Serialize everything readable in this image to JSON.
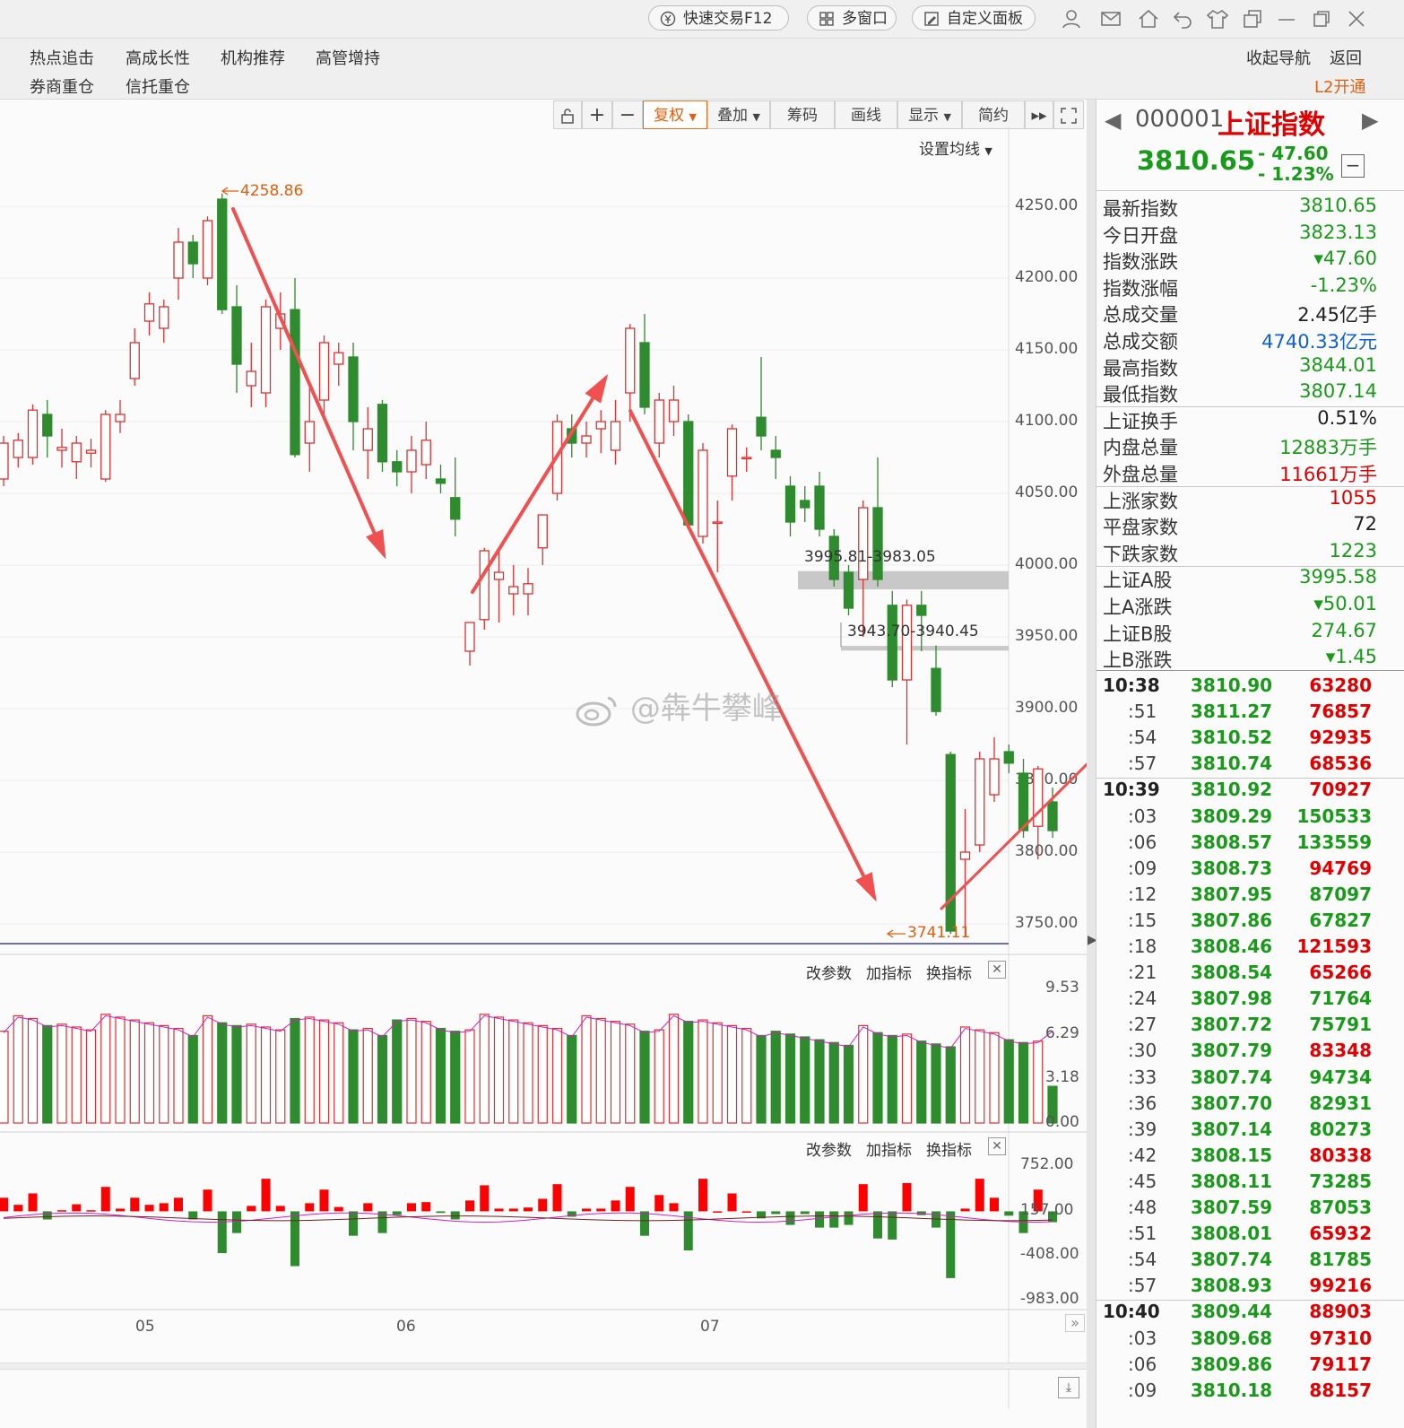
{
  "topbar": {
    "quick_trade": "快速交易F12",
    "multi_window": "多窗口",
    "custom_panel": "自定义面板"
  },
  "nav": {
    "row1": [
      "热点追击",
      "高成长性",
      "机构推荐",
      "高管增持"
    ],
    "row2": [
      "券商重仓",
      "信托重仓"
    ],
    "collapse": "收起导航",
    "back": "返回",
    "l2": "L2开通"
  },
  "toolbar": {
    "fuquan": "复权",
    "diejia": "叠加",
    "chouma": "筹码",
    "huaxian": "画线",
    "xianshi": "显示",
    "jianyue": "简约",
    "set_ma": "设置均线"
  },
  "colors": {
    "up": "#e03030",
    "down": "#2e8b2e",
    "arrow": "#f05050"
  },
  "chart_data": {
    "type": "candlestick",
    "price_ticks": [
      "4250.00",
      "4200.00",
      "4150.00",
      "4100.00",
      "4050.00",
      "4000.00",
      "3950.00",
      "3900.00",
      "3850.00",
      "3800.00",
      "3750.00"
    ],
    "x_ticks": [
      "05",
      "06",
      "07"
    ],
    "high_label": "4258.86",
    "low_label": "3741.11",
    "gaps": [
      {
        "label": "3995.81-3983.05",
        "low": 3983.05,
        "high": 3995.81
      },
      {
        "label": "3943.70-3940.45",
        "low": 3940.45,
        "high": 3943.7
      }
    ],
    "candles": [
      {
        "o": 4060,
        "c": 4085,
        "h": 4090,
        "l": 4055
      },
      {
        "o": 4075,
        "c": 4087,
        "h": 4092,
        "l": 4068
      },
      {
        "o": 4075,
        "c": 4108,
        "h": 4112,
        "l": 4070
      },
      {
        "o": 4105,
        "c": 4090,
        "h": 4115,
        "l": 4075
      },
      {
        "o": 4080,
        "c": 4082,
        "h": 4095,
        "l": 4068
      },
      {
        "o": 4072,
        "c": 4085,
        "h": 4090,
        "l": 4060
      },
      {
        "o": 4078,
        "c": 4080,
        "h": 4088,
        "l": 4068
      },
      {
        "o": 4060,
        "c": 4105,
        "h": 4108,
        "l": 4058
      },
      {
        "o": 4100,
        "c": 4105,
        "h": 4115,
        "l": 4092
      },
      {
        "o": 4130,
        "c": 4155,
        "h": 4165,
        "l": 4125
      },
      {
        "o": 4170,
        "c": 4182,
        "h": 4190,
        "l": 4160
      },
      {
        "o": 4165,
        "c": 4180,
        "h": 4185,
        "l": 4155
      },
      {
        "o": 4200,
        "c": 4225,
        "h": 4235,
        "l": 4185
      },
      {
        "o": 4225,
        "c": 4210,
        "h": 4230,
        "l": 4200
      },
      {
        "o": 4200,
        "c": 4240,
        "h": 4243,
        "l": 4195
      },
      {
        "o": 4255,
        "c": 4178,
        "h": 4259,
        "l": 4175
      },
      {
        "o": 4180,
        "c": 4140,
        "h": 4195,
        "l": 4120
      },
      {
        "o": 4125,
        "c": 4135,
        "h": 4155,
        "l": 4110
      },
      {
        "o": 4120,
        "c": 4180,
        "h": 4185,
        "l": 4110
      },
      {
        "o": 4165,
        "c": 4175,
        "h": 4190,
        "l": 4150
      },
      {
        "o": 4178,
        "c": 4077,
        "h": 4200,
        "l": 4075
      },
      {
        "o": 4085,
        "c": 4100,
        "h": 4125,
        "l": 4065
      },
      {
        "o": 4115,
        "c": 4155,
        "h": 4160,
        "l": 4105
      },
      {
        "o": 4140,
        "c": 4148,
        "h": 4155,
        "l": 4125
      },
      {
        "o": 4145,
        "c": 4100,
        "h": 4155,
        "l": 4080
      },
      {
        "o": 4080,
        "c": 4095,
        "h": 4110,
        "l": 4060
      },
      {
        "o": 4112,
        "c": 4072,
        "h": 4115,
        "l": 4065
      },
      {
        "o": 4072,
        "c": 4065,
        "h": 4080,
        "l": 4055
      },
      {
        "o": 4065,
        "c": 4080,
        "h": 4090,
        "l": 4050
      },
      {
        "o": 4070,
        "c": 4087,
        "h": 4100,
        "l": 4060
      },
      {
        "o": 4060,
        "c": 4057,
        "h": 4070,
        "l": 4050
      },
      {
        "o": 4047,
        "c": 4032,
        "h": 4075,
        "l": 4020
      },
      {
        "o": 3940,
        "c": 3960,
        "h": 3960,
        "l": 3930
      },
      {
        "o": 3962,
        "c": 4010,
        "h": 4012,
        "l": 3955
      },
      {
        "o": 3990,
        "c": 3995,
        "h": 4010,
        "l": 3960
      },
      {
        "o": 3980,
        "c": 3985,
        "h": 4000,
        "l": 3965
      },
      {
        "o": 3980,
        "c": 3987,
        "h": 3998,
        "l": 3965
      },
      {
        "o": 4012,
        "c": 4035,
        "h": 4035,
        "l": 4000
      },
      {
        "o": 4050,
        "c": 4100,
        "h": 4105,
        "l": 4045
      },
      {
        "o": 4095,
        "c": 4085,
        "h": 4105,
        "l": 4075
      },
      {
        "o": 4085,
        "c": 4090,
        "h": 4100,
        "l": 4075
      },
      {
        "o": 4095,
        "c": 4100,
        "h": 4108,
        "l": 4078
      },
      {
        "o": 4080,
        "c": 4100,
        "h": 4115,
        "l": 4070
      },
      {
        "o": 4120,
        "c": 4165,
        "h": 4168,
        "l": 4100
      },
      {
        "o": 4155,
        "c": 4110,
        "h": 4175,
        "l": 4105
      },
      {
        "o": 4085,
        "c": 4115,
        "h": 4120,
        "l": 4075
      },
      {
        "o": 4100,
        "c": 4115,
        "h": 4125,
        "l": 4090
      },
      {
        "o": 4100,
        "c": 4028,
        "h": 4105,
        "l": 4025
      },
      {
        "o": 4020,
        "c": 4080,
        "h": 4085,
        "l": 4015
      },
      {
        "o": 4030,
        "c": 4030,
        "h": 4045,
        "l": 3995
      },
      {
        "o": 4062,
        "c": 4095,
        "h": 4098,
        "l": 4045
      },
      {
        "o": 4075,
        "c": 4075,
        "h": 4082,
        "l": 4065
      },
      {
        "o": 4103,
        "c": 4090,
        "h": 4145,
        "l": 4080
      },
      {
        "o": 4080,
        "c": 4075,
        "h": 4090,
        "l": 4060
      },
      {
        "o": 4055,
        "c": 4030,
        "h": 4062,
        "l": 4020
      },
      {
        "o": 4045,
        "c": 4040,
        "h": 4055,
        "l": 4030
      },
      {
        "o": 4055,
        "c": 4025,
        "h": 4065,
        "l": 4020
      },
      {
        "o": 4020,
        "c": 3990,
        "h": 4025,
        "l": 3985
      },
      {
        "o": 3995,
        "c": 3970,
        "h": 4000,
        "l": 3965
      },
      {
        "o": 3990,
        "c": 4040,
        "h": 4045,
        "l": 3950
      },
      {
        "o": 4040,
        "c": 3990,
        "h": 4075,
        "l": 3985
      },
      {
        "o": 3972,
        "c": 3920,
        "h": 3982,
        "l": 3915
      },
      {
        "o": 3920,
        "c": 3972,
        "h": 3976,
        "l": 3875
      },
      {
        "o": 3972,
        "c": 3965,
        "h": 3982,
        "l": 3940
      },
      {
        "o": 3928,
        "c": 3898,
        "h": 3944,
        "l": 3895
      },
      {
        "o": 3868,
        "c": 3745,
        "h": 3870,
        "l": 3743
      },
      {
        "o": 3795,
        "c": 3800,
        "h": 3830,
        "l": 3741
      },
      {
        "o": 3805,
        "c": 3865,
        "h": 3870,
        "l": 3800
      },
      {
        "o": 3840,
        "c": 3865,
        "h": 3880,
        "l": 3835
      },
      {
        "o": 3870,
        "c": 3862,
        "h": 3875,
        "l": 3855
      },
      {
        "o": 3855,
        "c": 3815,
        "h": 3865,
        "l": 3810
      },
      {
        "o": 3818,
        "c": 3858,
        "h": 3860,
        "l": 3795
      },
      {
        "o": 3835,
        "c": 3815,
        "h": 3845,
        "l": 3810
      }
    ],
    "vol_ticks": [
      "9.53",
      "6.29",
      "3.18",
      "0.00"
    ],
    "macd_ticks": [
      "752.00",
      "157.00",
      "-408.00",
      "-983.00"
    ]
  },
  "panel_btns": {
    "param": "改参数",
    "add": "加指标",
    "swap": "换指标"
  },
  "watermark": "@犇牛攀峰",
  "stock": {
    "code": "000001",
    "name": "上证指数",
    "price": "3810.65",
    "change": "- 47.60",
    "change_pct": "- 1.23%"
  },
  "stats": [
    {
      "label": "最新指数",
      "value": "3810.65",
      "color": "#1a9a1a"
    },
    {
      "label": "今日开盘",
      "value": "3823.13",
      "color": "#1a9a1a"
    },
    {
      "label": "指数涨跌",
      "value": "▾47.60",
      "color": "#1a9a1a"
    },
    {
      "label": "指数涨幅",
      "value": "-1.23%",
      "color": "#1a9a1a"
    },
    {
      "label": "总成交量",
      "value": "2.45亿手",
      "color": "#222"
    },
    {
      "label": "总成交额",
      "value": "4740.33亿元",
      "color": "#1060d0"
    },
    {
      "label": "最高指数",
      "value": "3844.01",
      "color": "#1a9a1a"
    },
    {
      "label": "最低指数",
      "value": "3807.14",
      "color": "#1a9a1a"
    },
    {
      "label": "上证换手",
      "value": "0.51%",
      "color": "#222"
    },
    {
      "label": "内盘总量",
      "value": "12883万手",
      "color": "#1a9a1a"
    },
    {
      "label": "外盘总量",
      "value": "11661万手",
      "color": "#e00000"
    },
    {
      "label": "上涨家数",
      "value": "1055",
      "color": "#e00000"
    },
    {
      "label": "平盘家数",
      "value": "72",
      "color": "#222"
    },
    {
      "label": "下跌家数",
      "value": "1223",
      "color": "#1a9a1a"
    },
    {
      "label": "上证A股",
      "value": "3995.58",
      "color": "#1a9a1a"
    },
    {
      "label": "上A涨跌",
      "value": "▾50.01",
      "color": "#1a9a1a"
    },
    {
      "label": "上证B股",
      "value": "274.67",
      "color": "#1a9a1a"
    },
    {
      "label": "上B涨跌",
      "value": "▾1.45",
      "color": "#1a9a1a"
    }
  ],
  "ticks": [
    {
      "t": "10:38",
      "p": "3810.90",
      "v": "63280",
      "c": "#e00000"
    },
    {
      "t": ":51",
      "p": "3811.27",
      "v": "76857",
      "c": "#e00000"
    },
    {
      "t": ":54",
      "p": "3810.52",
      "v": "92935",
      "c": "#e00000"
    },
    {
      "t": ":57",
      "p": "3810.74",
      "v": "68536",
      "c": "#e00000"
    },
    {
      "t": "10:39",
      "p": "3810.92",
      "v": "70927",
      "c": "#e00000"
    },
    {
      "t": ":03",
      "p": "3809.29",
      "v": "150533",
      "c": "#1a9a1a"
    },
    {
      "t": ":06",
      "p": "3808.57",
      "v": "133559",
      "c": "#1a9a1a"
    },
    {
      "t": ":09",
      "p": "3808.73",
      "v": "94769",
      "c": "#e00000"
    },
    {
      "t": ":12",
      "p": "3807.95",
      "v": "87097",
      "c": "#1a9a1a"
    },
    {
      "t": ":15",
      "p": "3807.86",
      "v": "67827",
      "c": "#1a9a1a"
    },
    {
      "t": ":18",
      "p": "3808.46",
      "v": "121593",
      "c": "#e00000"
    },
    {
      "t": ":21",
      "p": "3808.54",
      "v": "65266",
      "c": "#e00000"
    },
    {
      "t": ":24",
      "p": "3807.98",
      "v": "71764",
      "c": "#1a9a1a"
    },
    {
      "t": ":27",
      "p": "3807.72",
      "v": "75791",
      "c": "#1a9a1a"
    },
    {
      "t": ":30",
      "p": "3807.79",
      "v": "83348",
      "c": "#e00000"
    },
    {
      "t": ":33",
      "p": "3807.74",
      "v": "94734",
      "c": "#1a9a1a"
    },
    {
      "t": ":36",
      "p": "3807.70",
      "v": "82931",
      "c": "#1a9a1a"
    },
    {
      "t": ":39",
      "p": "3807.14",
      "v": "80273",
      "c": "#1a9a1a"
    },
    {
      "t": ":42",
      "p": "3808.15",
      "v": "80338",
      "c": "#e00000"
    },
    {
      "t": ":45",
      "p": "3808.11",
      "v": "73285",
      "c": "#1a9a1a"
    },
    {
      "t": ":48",
      "p": "3807.59",
      "v": "87053",
      "c": "#1a9a1a"
    },
    {
      "t": ":51",
      "p": "3808.01",
      "v": "65932",
      "c": "#e00000"
    },
    {
      "t": ":54",
      "p": "3807.74",
      "v": "81785",
      "c": "#1a9a1a"
    },
    {
      "t": ":57",
      "p": "3808.93",
      "v": "99216",
      "c": "#e00000"
    },
    {
      "t": "10:40",
      "p": "3809.44",
      "v": "88903",
      "c": "#e00000"
    },
    {
      "t": ":03",
      "p": "3809.68",
      "v": "97310",
      "c": "#e00000"
    },
    {
      "t": ":06",
      "p": "3809.86",
      "v": "79117",
      "c": "#e00000"
    },
    {
      "t": ":09",
      "p": "3810.18",
      "v": "88157",
      "c": "#e00000"
    }
  ]
}
